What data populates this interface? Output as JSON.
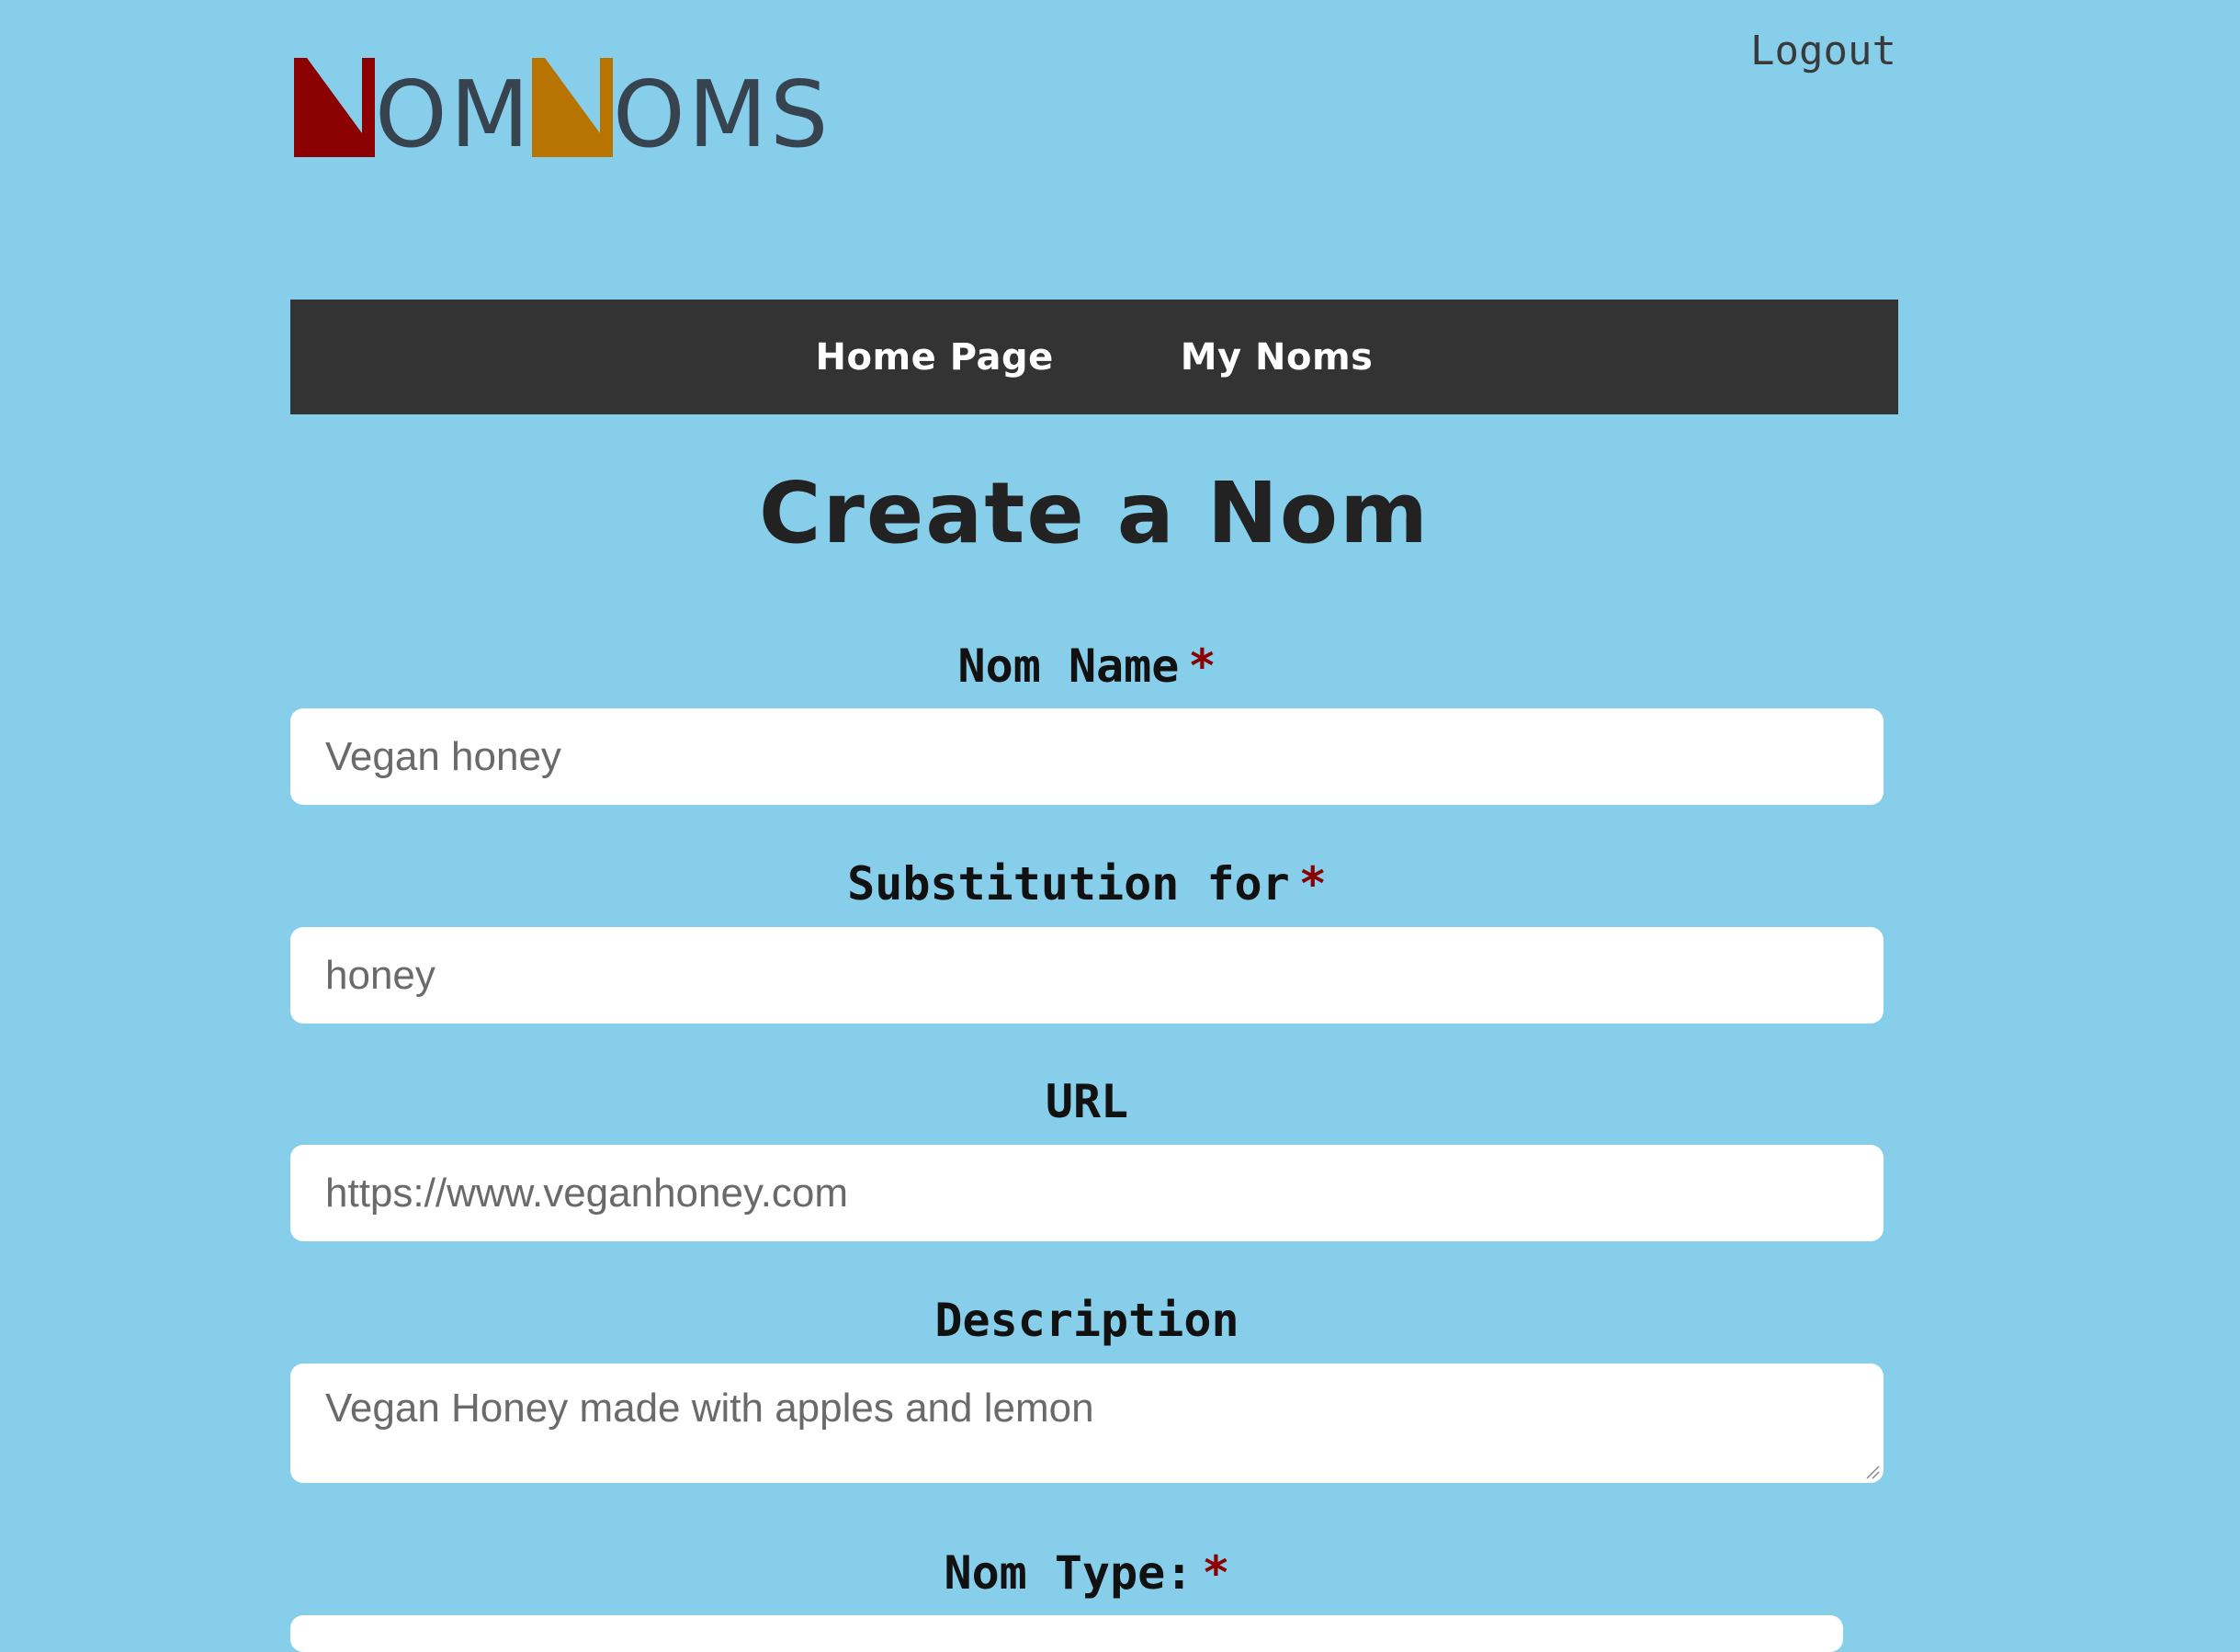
{
  "header": {
    "logo": {
      "text": "OMNOMS",
      "letter_colors": [
        "#8b0000",
        "#b87400"
      ]
    },
    "logout_label": "Logout"
  },
  "nav": {
    "items": [
      {
        "label": "Home Page"
      },
      {
        "label": "My Noms"
      }
    ]
  },
  "page_title": "Create a Nom",
  "form": {
    "nom_name": {
      "label": "Nom Name",
      "required_mark": "*",
      "placeholder": "Vegan honey"
    },
    "substitution": {
      "label": "Substitution for",
      "required_mark": "*",
      "placeholder": "honey"
    },
    "url": {
      "label": "URL",
      "placeholder": "https://www.veganhoney.com"
    },
    "description": {
      "label": "Description",
      "placeholder": "Vegan Honey made with apples and lemon"
    },
    "nom_type": {
      "label": "Nom Type:",
      "required_mark": "*"
    }
  },
  "colors": {
    "background": "#87ceea",
    "navbar": "#333333",
    "required": "#8b0000"
  }
}
